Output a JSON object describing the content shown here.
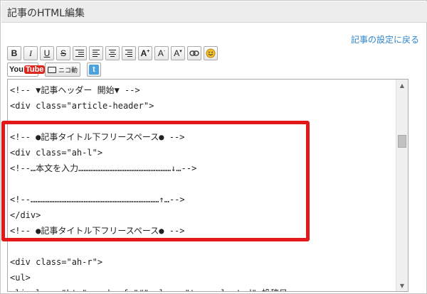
{
  "window": {
    "title": "記事のHTML編集"
  },
  "header": {
    "settings_link": "記事の設定に戻る"
  },
  "toolbar": {
    "bold": "B",
    "italic": "I",
    "underline": "U",
    "strike": "S",
    "font_up": "A",
    "font_down": "A",
    "font_color": "A",
    "font_up_sup": "+",
    "font_down_sup": "-",
    "font_color_sup": "▾"
  },
  "embed": {
    "youtube_you": "You",
    "youtube_tube": "Tube",
    "nico_label": "ニコ動",
    "twitter_label": "t"
  },
  "editor": {
    "lines": [
      "<!-- ▼記事ヘッダー 開始▼ -->",
      "<div class=\"article-header\">",
      "",
      "<!-- ●記事タイトル下フリースペース● -->",
      "<div class=\"ah-l\">",
      "<!--…本文を入力………………………………………………↓…-->",
      "",
      "<!--…………………………………………………………………↑…-->",
      "</div>",
      "<!-- ●記事タイトル下フリースペース● -->",
      "",
      "<div class=\"ah-r\">",
      "<ul>",
      "<li class=\"btn\"><a href=\"#\" class=\"tag-selected\">投稿日→<…"
    ]
  },
  "colors": {
    "highlight": "#e31818",
    "link": "#2f86c9",
    "youtube_red": "#d9281d",
    "twitter_blue": "#4aa3df",
    "smiley": "#f0c030"
  }
}
